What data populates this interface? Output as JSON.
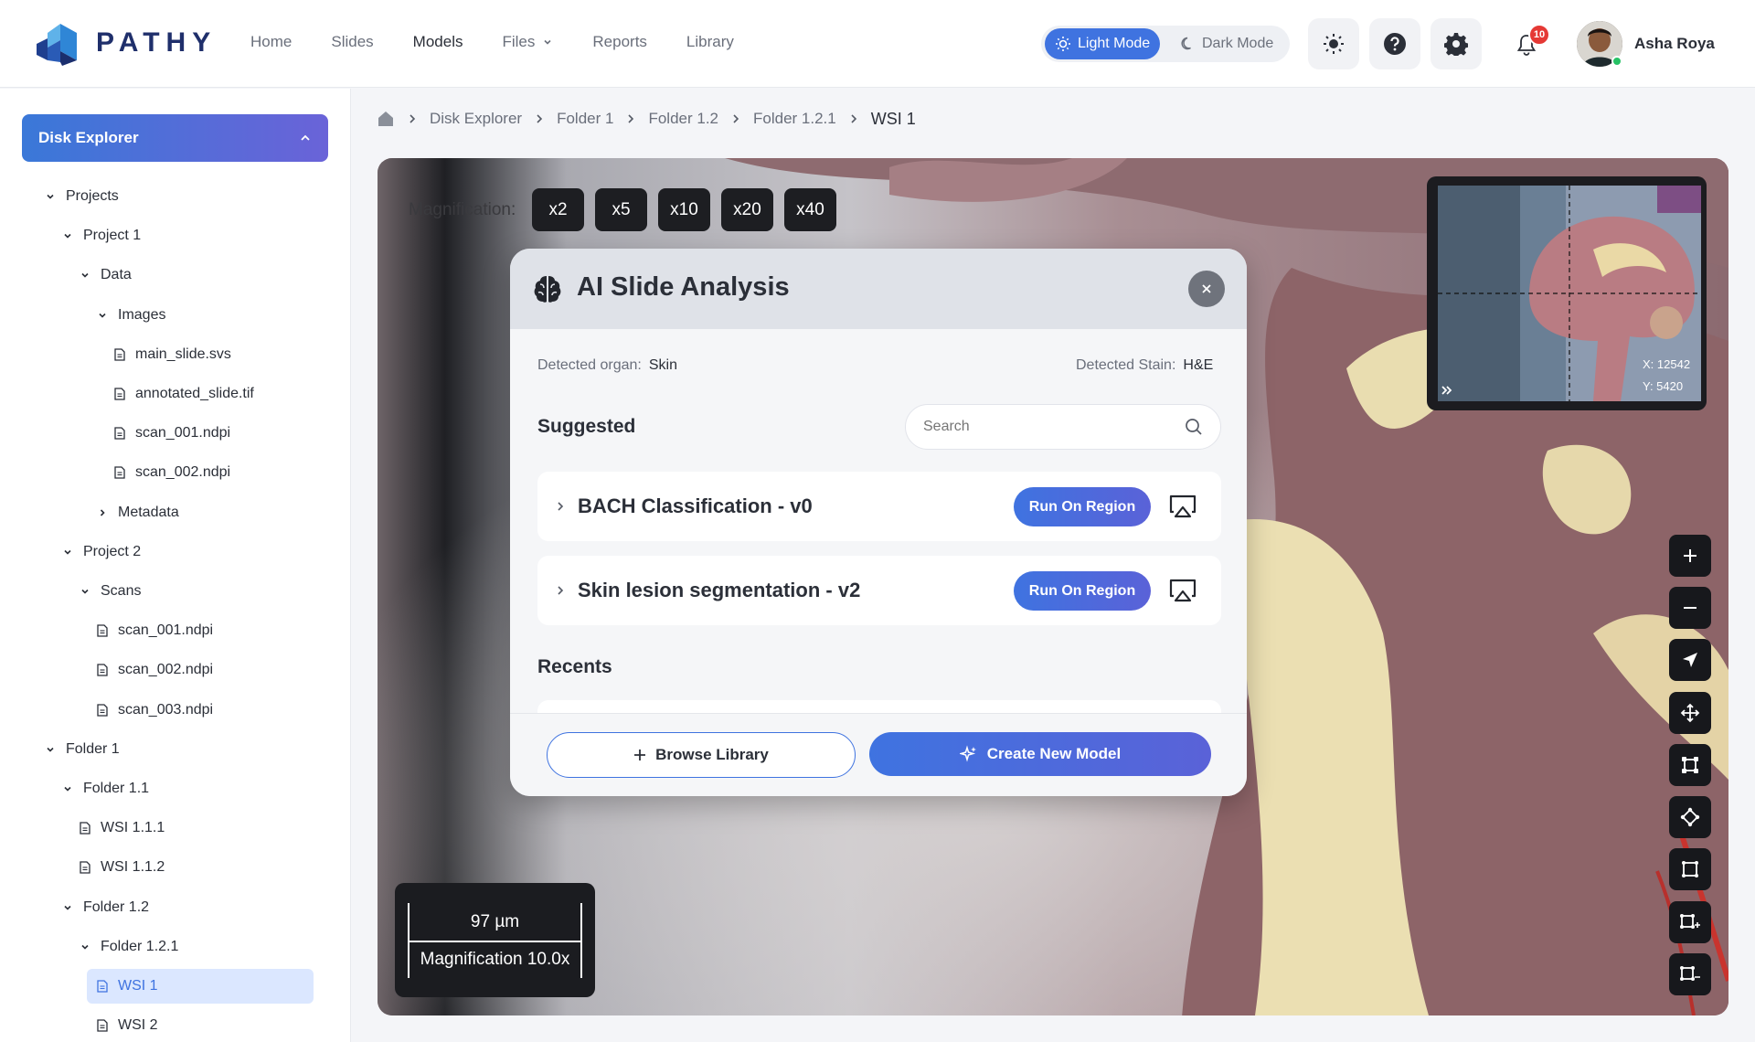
{
  "app": {
    "brand": "PATHY"
  },
  "nav": {
    "items": [
      {
        "label": "Home"
      },
      {
        "label": "Slides"
      },
      {
        "label": "Models"
      },
      {
        "label": "Files"
      },
      {
        "label": "Reports"
      },
      {
        "label": "Library"
      }
    ],
    "active": "Models"
  },
  "theme": {
    "light_label": "Light Mode",
    "dark_label": "Dark Mode",
    "selected": "Light Mode"
  },
  "header_icons": [
    "sun-icon",
    "help-icon",
    "gear-icon",
    "bell-icon"
  ],
  "notifications": {
    "count": "10"
  },
  "user": {
    "name": "Asha Roya",
    "status": "online"
  },
  "sidebar": {
    "header": "Disk Explorer",
    "tree": [
      {
        "label": "Projects",
        "type": "folder",
        "expanded": true
      },
      {
        "label": "Project 1",
        "type": "folder",
        "expanded": true
      },
      {
        "label": "Data",
        "type": "folder",
        "expanded": true
      },
      {
        "label": "Images",
        "type": "folder",
        "expanded": true
      },
      {
        "label": "main_slide.svs",
        "type": "file"
      },
      {
        "label": "annotated_slide.tif",
        "type": "file"
      },
      {
        "label": "scan_001.ndpi",
        "type": "file"
      },
      {
        "label": "scan_002.ndpi",
        "type": "file"
      },
      {
        "label": "Metadata",
        "type": "folder",
        "expanded": false
      },
      {
        "label": "Project 2",
        "type": "folder",
        "expanded": true
      },
      {
        "label": "Scans",
        "type": "folder",
        "expanded": true
      },
      {
        "label": "scan_001.ndpi",
        "type": "file"
      },
      {
        "label": "scan_002.ndpi",
        "type": "file"
      },
      {
        "label": "scan_003.ndpi",
        "type": "file"
      },
      {
        "label": "Folder 1",
        "type": "folder",
        "expanded": true
      },
      {
        "label": "Folder 1.1",
        "type": "folder",
        "expanded": true
      },
      {
        "label": "WSI 1.1.1",
        "type": "file"
      },
      {
        "label": "WSI 1.1.2",
        "type": "file"
      },
      {
        "label": "Folder 1.2",
        "type": "folder",
        "expanded": true
      },
      {
        "label": "Folder 1.2.1",
        "type": "folder",
        "expanded": true
      },
      {
        "label": "WSI 1",
        "type": "file",
        "selected": true
      },
      {
        "label": "WSI 2",
        "type": "file"
      }
    ]
  },
  "breadcrumb": [
    "Disk Explorer",
    "Folder 1",
    "Folder 1.2",
    "Folder 1.2.1",
    "WSI 1"
  ],
  "viewer": {
    "magnification_label": "Magnification:",
    "magnifications": [
      "x2",
      "x5",
      "x10",
      "x20",
      "x40"
    ],
    "minimap": {
      "x": "X: 12542",
      "y": "Y: 5420"
    },
    "scale": {
      "length": "97 µm",
      "magnification": "Magnification 10.0x"
    },
    "tools": [
      "zoom-in-icon",
      "zoom-out-icon",
      "navigate-icon",
      "move-icon",
      "rectangle-select-icon",
      "polygon-select-icon",
      "square-select-icon",
      "add-region-icon",
      "remove-region-icon"
    ]
  },
  "modal": {
    "title": "AI Slide Analysis",
    "detected_organ_label": "Detected organ:",
    "detected_organ": "Skin",
    "detected_stain_label": "Detected Stain:",
    "detected_stain": "H&E",
    "suggested_title": "Suggested",
    "search_placeholder": "Search",
    "models": [
      {
        "name": "BACH Classification - v0",
        "action": "Run On Region"
      },
      {
        "name": "Skin lesion segmentation - v2",
        "action": "Run On Region"
      }
    ],
    "recents_title": "Recents",
    "browse_label": "Browse Library",
    "create_label": "Create New Model"
  }
}
